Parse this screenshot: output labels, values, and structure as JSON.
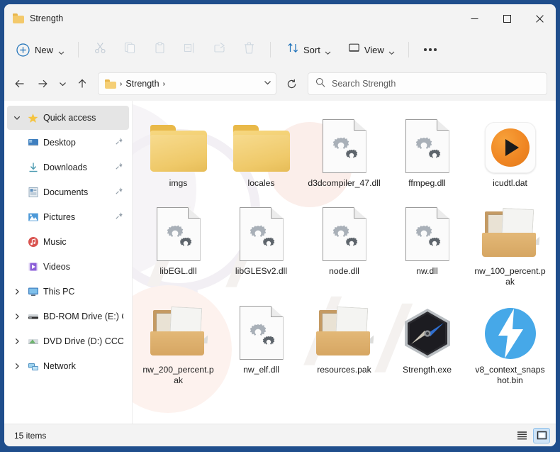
{
  "window": {
    "title": "Strength",
    "title_icon": "folder-icon",
    "controls": {
      "minimize": "minimize-icon",
      "maximize": "maximize-icon",
      "close": "close-icon"
    }
  },
  "toolbar": {
    "new_label": "New",
    "new_icon": "plus-circle-icon",
    "actions": [
      {
        "name": "cut-button",
        "icon": "scissors-icon",
        "disabled": true
      },
      {
        "name": "copy-button",
        "icon": "copy-icon",
        "disabled": true
      },
      {
        "name": "paste-button",
        "icon": "clipboard-icon",
        "disabled": true
      },
      {
        "name": "rename-button",
        "icon": "rename-icon",
        "disabled": true
      },
      {
        "name": "share-button",
        "icon": "share-icon",
        "disabled": true
      },
      {
        "name": "delete-button",
        "icon": "trash-icon",
        "disabled": true
      }
    ],
    "sort_label": "Sort",
    "sort_icon": "sort-arrows-icon",
    "view_label": "View",
    "view_icon": "monitor-icon",
    "more_label": "See more",
    "more_icon": "ellipsis-icon"
  },
  "address": {
    "back_icon": "arrow-left-icon",
    "forward_icon": "arrow-right-icon",
    "recent_icon": "chevron-down-icon",
    "up_icon": "arrow-up-icon",
    "crumb_icon": "folder-icon",
    "crumb_label": "Strength",
    "crumb_sep": "›",
    "dropdown_icon": "chevron-down-icon",
    "refresh_icon": "refresh-icon",
    "search_icon": "search-icon",
    "search_placeholder": "Search Strength",
    "search_value": ""
  },
  "sidebar": {
    "items": [
      {
        "label": "Quick access",
        "icon": "star-icon",
        "expander": "chevron-down-icon",
        "selected": true,
        "level": 0,
        "pinned": false
      },
      {
        "label": "Desktop",
        "icon": "desktop-icon",
        "expander": "",
        "selected": false,
        "level": 1,
        "pinned": true
      },
      {
        "label": "Downloads",
        "icon": "download-icon",
        "expander": "",
        "selected": false,
        "level": 1,
        "pinned": true
      },
      {
        "label": "Documents",
        "icon": "documents-icon",
        "expander": "",
        "selected": false,
        "level": 1,
        "pinned": true
      },
      {
        "label": "Pictures",
        "icon": "pictures-icon",
        "expander": "",
        "selected": false,
        "level": 1,
        "pinned": true
      },
      {
        "label": "Music",
        "icon": "music-icon",
        "expander": "",
        "selected": false,
        "level": 1,
        "pinned": false
      },
      {
        "label": "Videos",
        "icon": "videos-icon",
        "expander": "",
        "selected": false,
        "level": 1,
        "pinned": false
      },
      {
        "label": "This PC",
        "icon": "this-pc-icon",
        "expander": "chevron-right-icon",
        "selected": false,
        "level": 0,
        "pinned": false
      },
      {
        "label": "BD-ROM Drive (E:) C",
        "icon": "bd-rom-drive-icon",
        "expander": "chevron-right-icon",
        "selected": false,
        "level": 0,
        "pinned": false
      },
      {
        "label": "DVD Drive (D:) CCCC",
        "icon": "dvd-drive-icon",
        "expander": "chevron-right-icon",
        "selected": false,
        "level": 0,
        "pinned": false
      },
      {
        "label": "Network",
        "icon": "network-icon",
        "expander": "chevron-right-icon",
        "selected": false,
        "level": 0,
        "pinned": false
      }
    ]
  },
  "files": [
    {
      "name": "imgs",
      "type": "folder"
    },
    {
      "name": "locales",
      "type": "folder"
    },
    {
      "name": "d3dcompiler_47.dll",
      "type": "dll"
    },
    {
      "name": "ffmpeg.dll",
      "type": "dll"
    },
    {
      "name": "icudtl.dat",
      "type": "dat"
    },
    {
      "name": "libEGL.dll",
      "type": "dll"
    },
    {
      "name": "libGLESv2.dll",
      "type": "dll"
    },
    {
      "name": "node.dll",
      "type": "dll"
    },
    {
      "name": "nw.dll",
      "type": "dll"
    },
    {
      "name": "nw_100_percent.pak",
      "type": "pak"
    },
    {
      "name": "nw_200_percent.pak",
      "type": "pak"
    },
    {
      "name": "nw_elf.dll",
      "type": "dll"
    },
    {
      "name": "resources.pak",
      "type": "pak"
    },
    {
      "name": "Strength.exe",
      "type": "exe"
    },
    {
      "name": "v8_context_snapshot.bin",
      "type": "bin"
    }
  ],
  "statusbar": {
    "items_count": "15 items",
    "list_view_icon": "list-view-icon",
    "details_view_icon": "large-icons-view-icon",
    "active_view": "large-icons-view-icon"
  },
  "colors": {
    "window_border": "#1f4e8c",
    "chrome_bg": "#f3f3f3",
    "accent_blue": "#0f6cbd",
    "folder_yellow": "#efc969",
    "selection": "#cfe4f7"
  },
  "watermark": {
    "text": "PCRISK"
  }
}
